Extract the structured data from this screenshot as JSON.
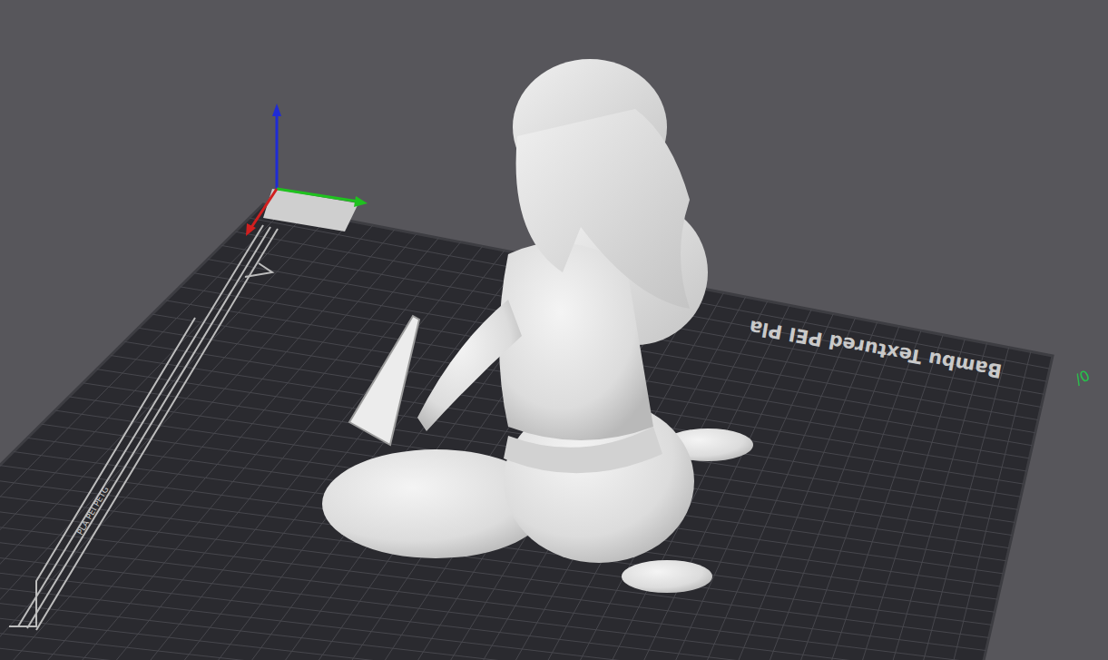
{
  "viewport": {
    "plate_label": "Bambu Textured PEI Pla",
    "plate_strip_label": "PLA PEI PETG",
    "edge_mark": "/0"
  }
}
